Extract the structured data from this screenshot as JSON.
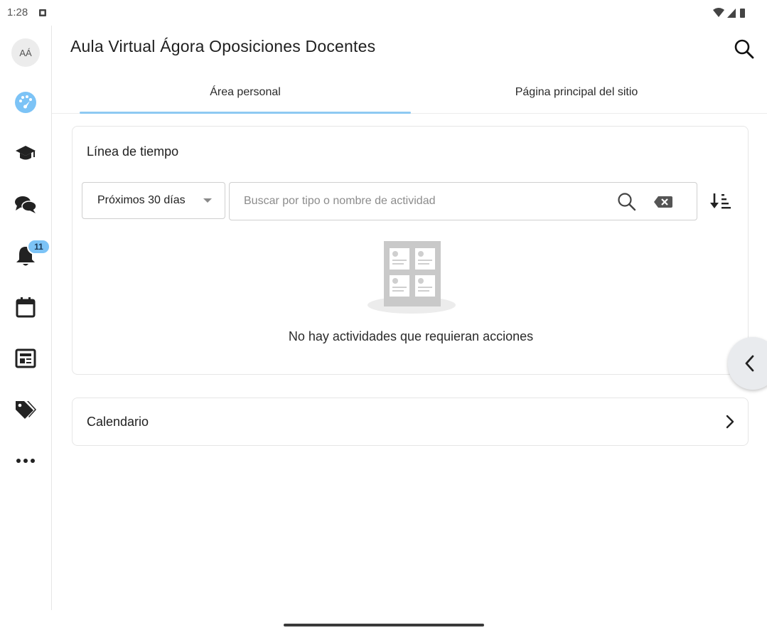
{
  "status_bar": {
    "time": "1:28",
    "icons": [
      "sim-icon",
      "wifi-icon",
      "signal-icon",
      "battery-icon"
    ]
  },
  "side_rail": {
    "avatar_initials": "AÁ",
    "items": [
      {
        "name": "dashboard",
        "icon": "speedometer-icon",
        "active": true
      },
      {
        "name": "courses",
        "icon": "graduation-cap-icon"
      },
      {
        "name": "messages",
        "icon": "chat-bubbles-icon"
      },
      {
        "name": "notifications",
        "icon": "bell-icon",
        "badge": "11"
      },
      {
        "name": "calendar",
        "icon": "calendar-icon"
      },
      {
        "name": "news",
        "icon": "newspaper-icon"
      },
      {
        "name": "tags",
        "icon": "tags-icon"
      },
      {
        "name": "more",
        "icon": "more-dots-icon"
      }
    ],
    "active_color": "#7cc3f6"
  },
  "header": {
    "title": "Aula Virtual Ágora Oposiciones Docentes"
  },
  "tabs": [
    {
      "label": "Área personal",
      "selected": true
    },
    {
      "label": "Página principal del sitio",
      "selected": false
    }
  ],
  "timeline": {
    "title": "Línea de tiempo",
    "filter_value": "Próximos 30 días",
    "search_placeholder": "Buscar por tipo o nombre de actividad",
    "search_value": "",
    "empty_message": "No hay actividades que requieran acciones"
  },
  "calendar_card": {
    "label": "Calendario"
  },
  "colors": {
    "accent": "#8ec9f2",
    "badge": "#7cc3f6",
    "border": "#e6e6e6"
  }
}
